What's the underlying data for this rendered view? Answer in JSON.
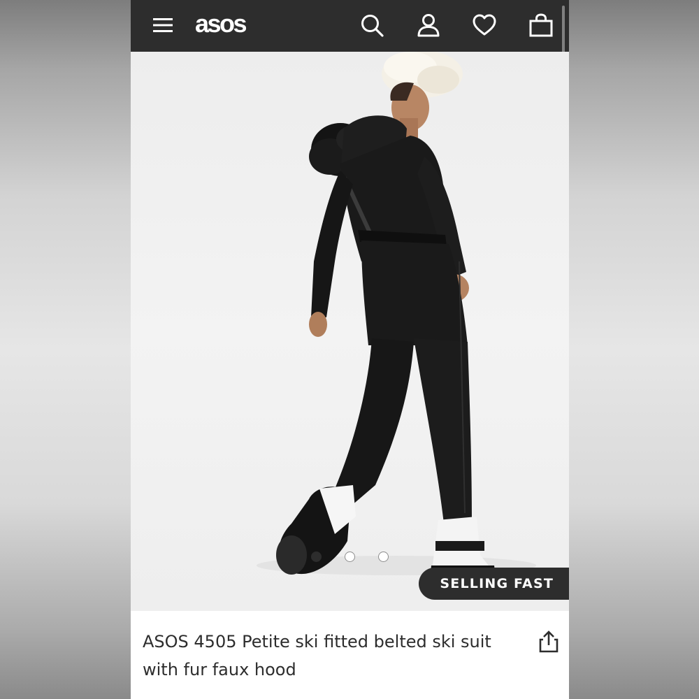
{
  "header": {
    "logo_text": "asos",
    "icons": [
      "menu-icon",
      "search-icon",
      "account-icon",
      "heart-icon",
      "bag-icon"
    ],
    "background_color": "#2d2d2d"
  },
  "product": {
    "image_description_icon": "product-photo",
    "carousel": {
      "dot_count": 3,
      "active_index": 0
    },
    "badge_label": "SELLING FAST",
    "title": "ASOS 4505 Petite ski fitted belted ski suit with fur faux hood",
    "share_icon": "share-icon"
  },
  "colors": {
    "accent": "#2d2d2d",
    "text": "#2d2d2d",
    "image_bg": "#efefef"
  }
}
